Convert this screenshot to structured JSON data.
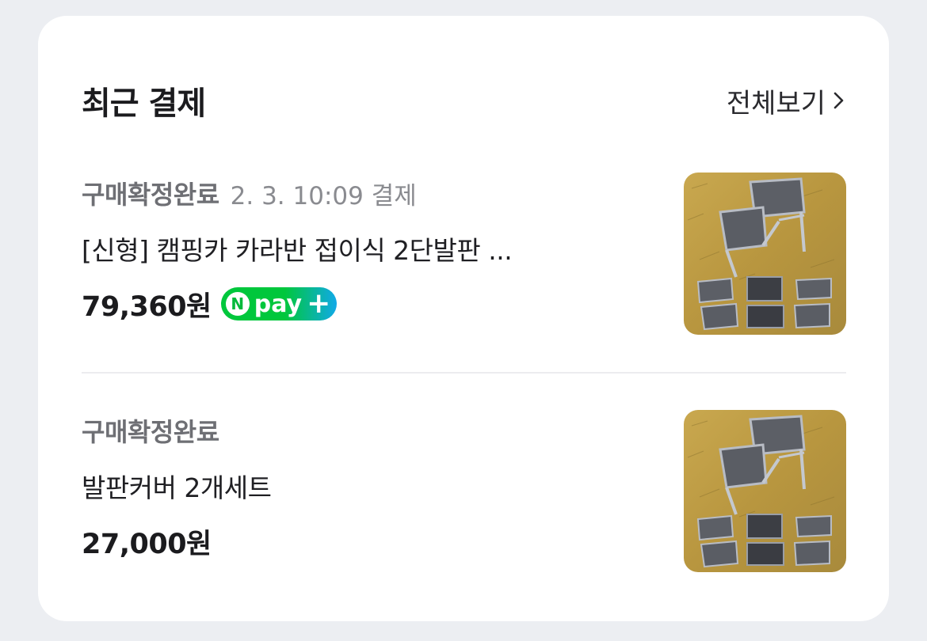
{
  "header": {
    "title": "최근 결제",
    "view_all": "전체보기"
  },
  "payments": [
    {
      "status": "구매확정완료",
      "date": "2. 3. 10:09 결제",
      "name": "[신형] 캠핑카 카라반 접이식 2단발판 ...",
      "price": "79,360원",
      "badge": "pay"
    },
    {
      "status": "구매확정완료",
      "name": "발판커버 2개세트",
      "price": "27,000원"
    }
  ],
  "colors": {
    "background": "#eceef2",
    "card": "#ffffff",
    "npay_green": "#00c73c",
    "npay_blue": "#11a9e8"
  },
  "icons": [
    "chevron-right-icon",
    "npay-logo",
    "step-stool-photo"
  ]
}
